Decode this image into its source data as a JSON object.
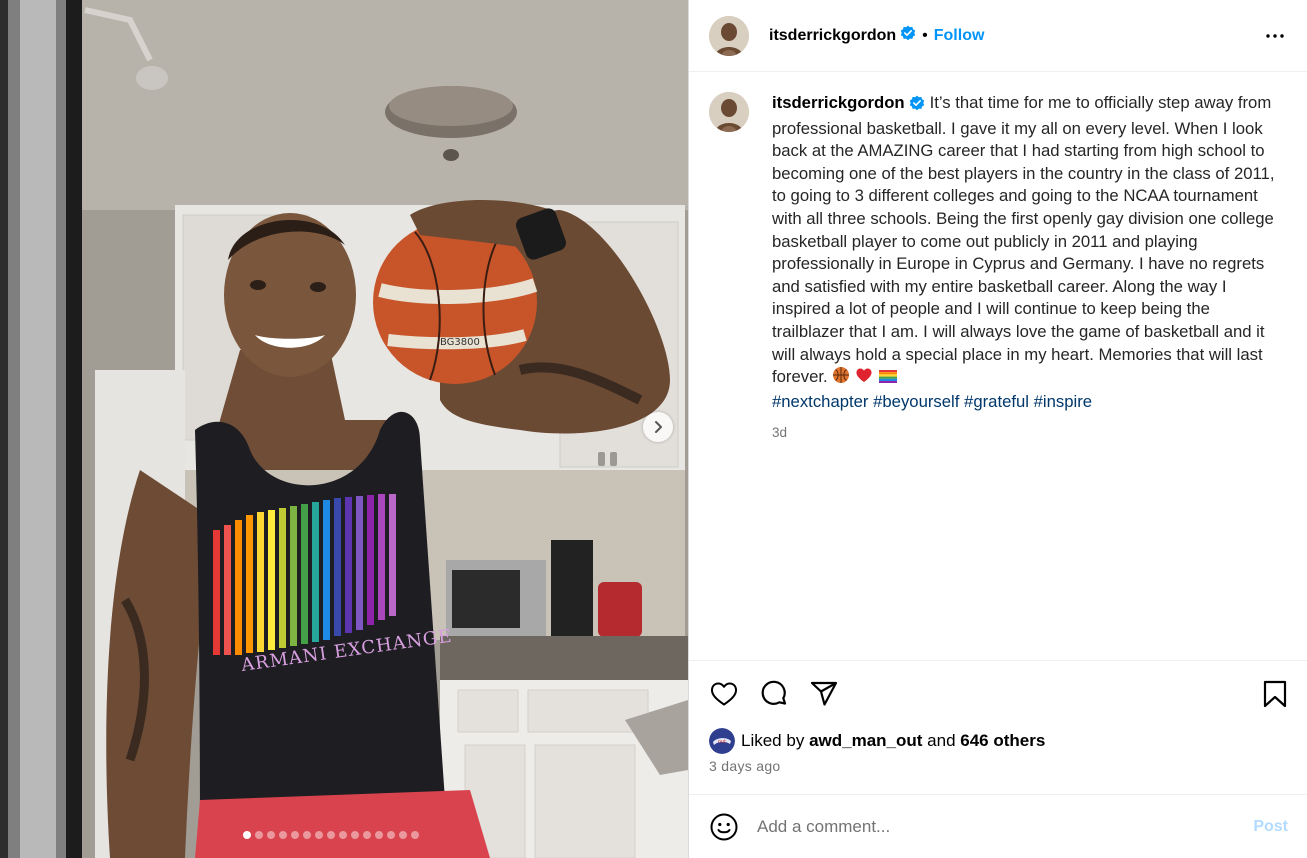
{
  "header": {
    "username": "itsderrickgordon",
    "separator": "•",
    "follow_label": "Follow"
  },
  "caption": {
    "username": "itsderrickgordon",
    "text": "It’s that time for me to officially step away from professional basketball. I gave it my all on every level. When I look back at the AMAZING career that I had starting from high school to becoming one of the best players in the country in the class of 2011, to going to 3 different colleges and going to the NCAA tournament with all three schools. Being the first openly gay division one college basketball player to come out publicly in 2011 and playing professionally in Europe in Cyprus and Germany. I have no regrets and satisfied with my entire basketball career. Along the way I inspired a lot of people and I will continue to keep being the trailblazer that I am. I will always love the game of basketball and it will always hold a special place in my heart. Memories that will last forever.",
    "emojis": [
      "basketball-emoji",
      "red-heart-emoji",
      "rainbow-flag-emoji"
    ],
    "hashtags": [
      "#nextchapter",
      "#beyourself",
      "#grateful",
      "#inspire"
    ],
    "time_short": "3d"
  },
  "likes": {
    "prefix": "Liked by",
    "liker": "awd_man_out",
    "conjunction": "and",
    "others": "646 others"
  },
  "time_ago": "3 days ago",
  "comment": {
    "placeholder": "Add a comment...",
    "post_label": "Post"
  },
  "carousel": {
    "slide_count": 15,
    "active_index": 0
  },
  "photo": {
    "shirt_text": "ARMANI EXCHANGE",
    "ball_text": "BG3800"
  },
  "colors": {
    "accent": "#0095f6",
    "post_disabled": "#b3dbff",
    "hashtag": "#00376b",
    "muted": "#737373",
    "heart": "#ed4956"
  }
}
